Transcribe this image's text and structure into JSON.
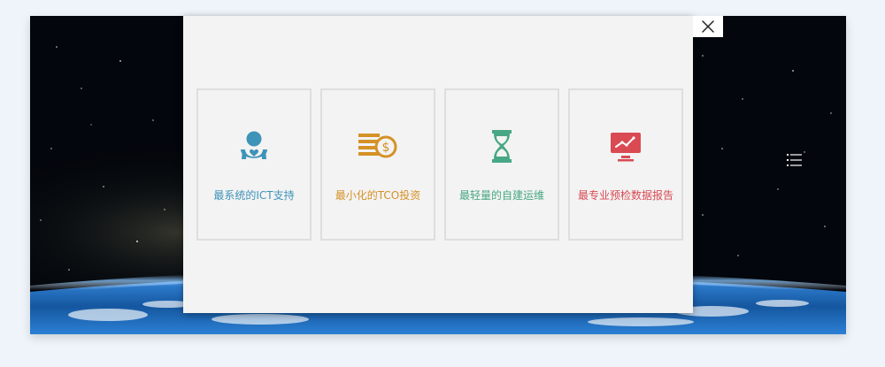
{
  "close_button": {
    "icon": "close-icon"
  },
  "side_menu": {
    "icon": "list-menu-icon"
  },
  "cards": [
    {
      "label": "最系统的ICT支持",
      "icon": "user-heart-icon",
      "color": "#3e93b8"
    },
    {
      "label": "最小化的TCO投资",
      "icon": "coin-stack-icon",
      "color": "#d59126"
    },
    {
      "label": "最轻量的自建运维",
      "icon": "hourglass-icon",
      "color": "#48a784"
    },
    {
      "label": "最专业预检数据报告",
      "icon": "monitor-chart-icon",
      "color": "#d94a52"
    }
  ]
}
